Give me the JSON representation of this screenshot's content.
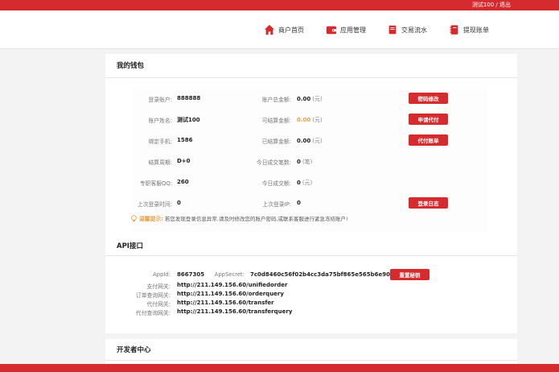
{
  "topbar": {
    "user": "测试100 / 退出"
  },
  "nav": [
    {
      "label": "商户首页",
      "icon": "home-icon"
    },
    {
      "label": "应用管理",
      "icon": "wallet-icon"
    },
    {
      "label": "交易流水",
      "icon": "book-icon"
    },
    {
      "label": "提现账单",
      "icon": "notebook-icon"
    }
  ],
  "wallet": {
    "title": "我的钱包",
    "login_account": {
      "label": "登录账户:",
      "value": "888888"
    },
    "account_name": {
      "label": "账户姓名:",
      "value": "测试100"
    },
    "bound_phone": {
      "label": "绑定手机:",
      "value": "1586"
    },
    "settle_cycle": {
      "label": "结算周期:",
      "value": "D+0"
    },
    "support_qq": {
      "label": "专职客服QQ:",
      "value": "260"
    },
    "last_login_time": {
      "label": "上次登录时间:",
      "value": "0"
    },
    "total_balance": {
      "label": "账户总金额:",
      "value": "0.00",
      "unit": "(元)"
    },
    "settleable": {
      "label": "可结算金额:",
      "value": "0.00",
      "unit": "(元)"
    },
    "settled": {
      "label": "已结算金额:",
      "value": "0.00",
      "unit": "(元)"
    },
    "today_count": {
      "label": "今日成交笔数:",
      "value": "0",
      "unit": "(笔)"
    },
    "today_amount": {
      "label": "今日成交额:",
      "value": "0",
      "unit": "(元)"
    },
    "last_login_ip": {
      "label": "上次登录IP:",
      "value": "0"
    },
    "buttons": {
      "change_password": "密码修改",
      "apply_payout": "申请代付",
      "payout_bill": "代付账单",
      "login_log": "登录日志"
    },
    "tip": {
      "label": "温馨提示:",
      "text": "若您发现登录信息异常,请及时修改您的账户密码,或联系客服进行紧急冻结账户!"
    }
  },
  "api": {
    "title": "API接口",
    "appid": {
      "label": "AppId:",
      "value": "8667305"
    },
    "appsecret": {
      "label": "AppSecret:",
      "value": "7c0d8460c56f02b4cc3da75bf865e565b6e9072c"
    },
    "reset_secret_button": "重置秘钥",
    "gateways": [
      {
        "label": "支付网关:",
        "value": "http://211.149.156.60/unifiedorder"
      },
      {
        "label": "订单查询网关:",
        "value": "http://211.149.156.60/orderquery"
      },
      {
        "label": "代付网关:",
        "value": "http://211.149.156.60/transfer"
      },
      {
        "label": "代付查询网关:",
        "value": "http://211.149.156.60/transferquery"
      }
    ]
  },
  "developer": {
    "title": "开发者中心"
  },
  "colors": {
    "primary": "#d52b2f",
    "accent": "#e8a24a"
  }
}
